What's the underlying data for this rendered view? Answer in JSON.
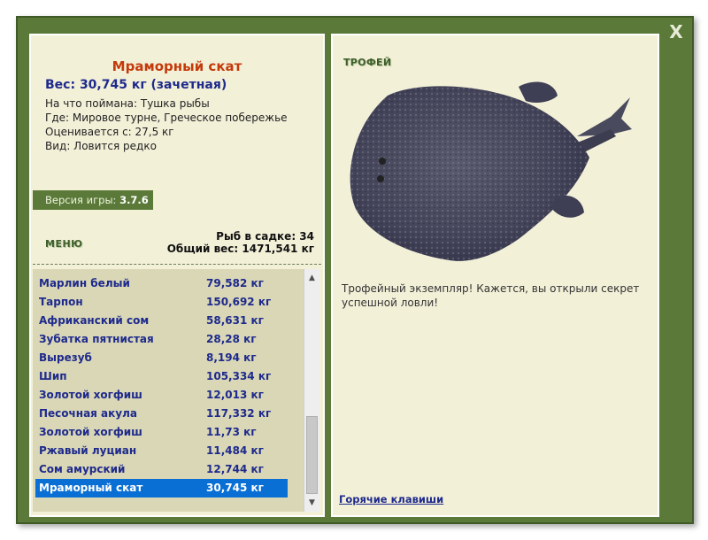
{
  "close_label": "X",
  "fish": {
    "name": "Мраморный скат",
    "weight": "Вес: 30,745 кг (зачетная)",
    "bait": "На что поймана: Тушка рыбы",
    "location": "Где: Мировое турне, Греческое побережье",
    "price": "Оценивается с: 27,5 кг",
    "rarity": "Вид: Ловится редко"
  },
  "version": {
    "label": "Версия игры:",
    "value": "3.7.6"
  },
  "menu_label": "МЕНЮ",
  "stats": {
    "count": "Рыб в садке: 34",
    "total": "Общий вес: 1471,541 кг"
  },
  "catch_list": [
    {
      "name": "Марлин белый",
      "weight": "79,582 кг"
    },
    {
      "name": "Тарпон",
      "weight": "150,692 кг"
    },
    {
      "name": "Африканский сом",
      "weight": "58,631 кг"
    },
    {
      "name": "Зубатка пятнистая",
      "weight": "28,28 кг"
    },
    {
      "name": "Вырезуб",
      "weight": "8,194 кг"
    },
    {
      "name": "Шип",
      "weight": "105,334 кг"
    },
    {
      "name": "Золотой хогфиш",
      "weight": "12,013 кг"
    },
    {
      "name": "Песочная акула",
      "weight": "117,332 кг"
    },
    {
      "name": "Золотой хогфиш",
      "weight": "11,73 кг"
    },
    {
      "name": "Ржавый луциан",
      "weight": "11,484 кг"
    },
    {
      "name": "Сом амурский",
      "weight": "12,744 кг"
    },
    {
      "name": "Мраморный скат",
      "weight": "30,745 кг"
    }
  ],
  "selected_index": 11,
  "trophy": {
    "label": "ТРОФЕЙ",
    "text": "Трофейный экземпляр! Кажется, вы открыли секрет успешной ловли!"
  },
  "hotkeys_label": "Горячие клавиши",
  "colors": {
    "frame": "#5b7a3a",
    "panel": "#f3f0d8",
    "list_bg": "#d9d7b6",
    "selected": "#0a6fd4",
    "fish_name": "#c43a0a",
    "link": "#1e2a8c"
  }
}
